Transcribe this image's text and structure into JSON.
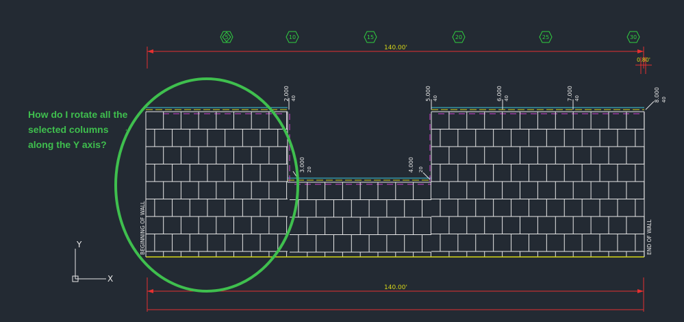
{
  "question": {
    "text": "How do I rotate all the\nselected columns\nalong the Y axis?"
  },
  "grid_markers": [
    "5",
    "10",
    "15",
    "20",
    "25",
    "30"
  ],
  "dimensions": {
    "top_total": "140.00'",
    "bottom_total": "140.00'",
    "offset": "0.80'"
  },
  "elevations": [
    {
      "id": "e1",
      "value": "2.000",
      "sub": "40"
    },
    {
      "id": "e2",
      "value": "3.000",
      "sub": "20"
    },
    {
      "id": "e3",
      "value": "4.000",
      "sub": "20"
    },
    {
      "id": "e4",
      "value": "5.000",
      "sub": "40"
    },
    {
      "id": "e5",
      "value": "6.000",
      "sub": "40"
    },
    {
      "id": "e6",
      "value": "7.000",
      "sub": "40"
    },
    {
      "id": "e7",
      "value": "8.000",
      "sub": "40"
    }
  ],
  "wall_labels": {
    "begin": "BEGINNING OF WALL",
    "end": "END OF WALL"
  },
  "ucs": {
    "x": "X",
    "y": "Y"
  },
  "colors": {
    "background": "#232a33",
    "red": "#e53030",
    "green": "#3fbf4e",
    "white": "#e8e8e8",
    "yellow": "#d8d818",
    "magenta": "#d040d0",
    "cyan": "#3ec8d8",
    "marker": "#30d040"
  }
}
